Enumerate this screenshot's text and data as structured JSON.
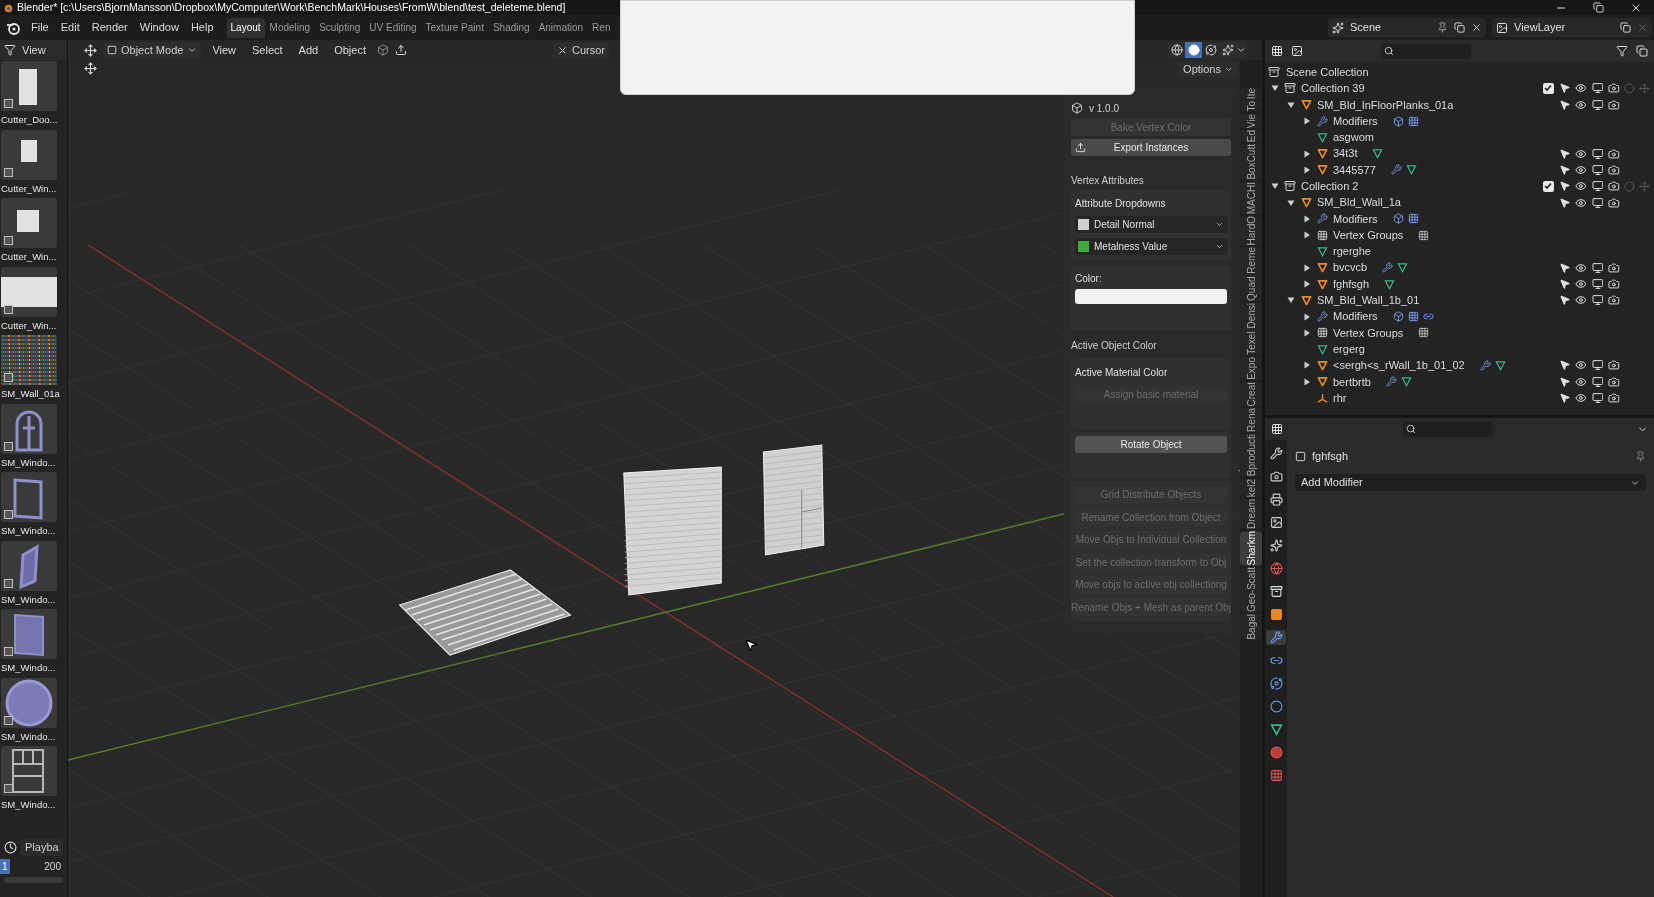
{
  "window": {
    "title": "Blender* [c:\\Users\\BjornMansson\\Dropbox\\MyComputer\\Work\\BenchMark\\Houses\\FromW\\blend\\test_deleteme.blend]"
  },
  "menu": [
    "File",
    "Edit",
    "Render",
    "Window",
    "Help"
  ],
  "workspaces": [
    {
      "label": "Layout",
      "selected": true
    },
    {
      "label": "Modeling",
      "selected": false
    },
    {
      "label": "Sculpting",
      "selected": false
    },
    {
      "label": "UV Editing",
      "selected": false
    },
    {
      "label": "Texture Paint",
      "selected": false
    },
    {
      "label": "Shading",
      "selected": false
    },
    {
      "label": "Animation",
      "selected": false
    },
    {
      "label": "Ren",
      "selected": false
    }
  ],
  "scene": "Scene",
  "view_layer": "ViewLayer",
  "asset_browser": {
    "menu": "View",
    "assets": [
      {
        "name": "Cutter_Doo...",
        "kind": "door"
      },
      {
        "name": "Cutter_Win...",
        "kind": "window-small"
      },
      {
        "name": "Cutter_Win...",
        "kind": "window-square"
      },
      {
        "name": "Cutter_Win...",
        "kind": "window-wide"
      },
      {
        "name": "SM_Wall_01a",
        "kind": "noise"
      },
      {
        "name": "SM_Windo...",
        "kind": "arch"
      },
      {
        "name": "SM_Windo...",
        "kind": "frame"
      },
      {
        "name": "SM_Windo...",
        "kind": "slanted"
      },
      {
        "name": "SM_Windo...",
        "kind": "panel"
      },
      {
        "name": "SM_Windo...",
        "kind": "round"
      },
      {
        "name": "SM_Windo...",
        "kind": "sash"
      }
    ]
  },
  "timeline": {
    "playback": "Playba",
    "start": "1",
    "end": "200"
  },
  "viewport": {
    "mode": "Object Mode",
    "menus": [
      "View",
      "Select",
      "Add",
      "Object"
    ],
    "cursor_tool": "Cursor",
    "options": "Options",
    "shading": [
      {
        "kind": "wireframe",
        "selected": false
      },
      {
        "kind": "solid",
        "selected": true
      },
      {
        "kind": "material",
        "selected": false
      },
      {
        "kind": "rendered",
        "selected": false
      }
    ]
  },
  "sidebar": {
    "version": "v 1.0.0",
    "top_buttons": [
      {
        "label": "Bake Vertex Color",
        "disabled": true
      },
      {
        "label": "Export Instances",
        "disabled": false
      }
    ],
    "vertex_attributes": "Vertex Attributes",
    "dropdown_box": "Attribute Dropdowns",
    "dropdowns": [
      {
        "label": "Detail Normal",
        "color": "#d0d0d0"
      },
      {
        "label": "Metalness Value",
        "color": "#3caa3c"
      }
    ],
    "color_label": "Color:",
    "color_swatch": {
      "color": "#f2f2f0"
    },
    "active_object_color": "Active Object Color",
    "material_box": "Active Material Color",
    "assign_button": {
      "label": "Assign basic material",
      "disabled": true
    },
    "rotate_button": {
      "label": "Rotate Object",
      "disabled": false
    },
    "tools": [
      {
        "label": "Grid Distribute Objects",
        "disabled": true
      },
      {
        "label": "Rename Collection from Object",
        "disabled": true
      },
      {
        "label": "Move Objs to Individual Collection",
        "disabled": true
      },
      {
        "label": "Set the collection transform to Obj",
        "disabled": true
      },
      {
        "label": "Move objs to active obj collectiong",
        "disabled": true
      },
      {
        "label": "Rename Objs + Mesh as parent Obj",
        "disabled": true
      }
    ]
  },
  "sidebar_tabs": [
    {
      "label": "Ite",
      "selected": false
    },
    {
      "label": "To",
      "selected": false
    },
    {
      "label": "Vie",
      "selected": false
    },
    {
      "label": "Ed",
      "selected": false
    },
    {
      "label": "BoxCutt",
      "selected": false
    },
    {
      "label": "MACHI",
      "selected": false
    },
    {
      "label": "HardO",
      "selected": false
    },
    {
      "label": "Quad Reme",
      "selected": false
    },
    {
      "label": "Texel Densi",
      "selected": false
    },
    {
      "label": "Expo",
      "selected": false
    },
    {
      "label": "Creat",
      "selected": false
    },
    {
      "label": "Rena",
      "selected": false
    },
    {
      "label": "Bproducti",
      "selected": false
    },
    {
      "label": "kel2",
      "selected": false
    },
    {
      "label": "Dream",
      "selected": false
    },
    {
      "label": "Sharkm",
      "selected": true
    },
    {
      "label": "Geo-Scatt",
      "selected": false
    },
    {
      "label": "Bagal",
      "selected": false
    }
  ],
  "outliner": {
    "root": "Scene Collection",
    "items": [
      {
        "name": "Collection 39",
        "kind": "collection",
        "expanded": true,
        "checked": true,
        "children": [
          {
            "name": "SM_Bld_InFloorPlanks_01a",
            "kind": "object",
            "expanded": true,
            "children": [
              {
                "name": "Modifiers",
                "kind": "modifiers",
                "expanded": false,
                "extras": [
                  {
                    "kind": "mod-box"
                  },
                  {
                    "kind": "mod-grid"
                  }
                ]
              },
              {
                "name": "asgwom",
                "kind": "mesh-data"
              },
              {
                "name": "34t3t",
                "kind": "object",
                "expanded": false,
                "extras": [
                  {
                    "kind": "mesh"
                  }
                ]
              },
              {
                "name": "3445577",
                "kind": "object",
                "expanded": false,
                "extras": [
                  {
                    "kind": "wrench"
                  },
                  {
                    "kind": "mesh"
                  }
                ]
              }
            ]
          }
        ]
      },
      {
        "name": "Collection 2",
        "kind": "collection",
        "expanded": true,
        "checked": true,
        "children": [
          {
            "name": "SM_Bld_Wall_1a",
            "kind": "object",
            "expanded": true,
            "children": [
              {
                "name": "Modifiers",
                "kind": "modifiers",
                "expanded": false,
                "extras": [
                  {
                    "kind": "mod-box"
                  },
                  {
                    "kind": "mod-grid"
                  }
                ]
              },
              {
                "name": "Vertex Groups",
                "kind": "vertex-groups",
                "expanded": false,
                "extras": [
                  {
                    "kind": "vgroup"
                  }
                ]
              },
              {
                "name": "rgerghe",
                "kind": "mesh-data"
              },
              {
                "name": "bvcvcb",
                "kind": "object",
                "expanded": false,
                "extras": [
                  {
                    "kind": "wrench"
                  },
                  {
                    "kind": "mesh"
                  }
                ]
              },
              {
                "name": "fghfsgh",
                "kind": "object",
                "expanded": false,
                "extras": [
                  {
                    "kind": "mesh"
                  }
                ]
              }
            ]
          },
          {
            "name": "SM_Bld_Wall_1b_01",
            "kind": "object",
            "expanded": true,
            "children": [
              {
                "name": "Modifiers",
                "kind": "modifiers",
                "expanded": false,
                "extras": [
                  {
                    "kind": "mod-box"
                  },
                  {
                    "kind": "mod-grid"
                  },
                  {
                    "kind": "mod-mirror"
                  }
                ]
              },
              {
                "name": "Vertex Groups",
                "kind": "vertex-groups",
                "expanded": false,
                "extras": [
                  {
                    "kind": "vgroup"
                  }
                ]
              },
              {
                "name": "ergerg",
                "kind": "mesh-data"
              },
              {
                "name": "<sergh<s_rWall_1b_01_02",
                "kind": "object",
                "expanded": false,
                "extras": [
                  {
                    "kind": "wrench"
                  },
                  {
                    "kind": "mesh"
                  }
                ]
              },
              {
                "name": "bertbrtb",
                "kind": "object",
                "expanded": false,
                "extras": [
                  {
                    "kind": "wrench"
                  },
                  {
                    "kind": "mesh"
                  }
                ]
              },
              {
                "name": "rhr",
                "kind": "empty"
              }
            ]
          }
        ]
      }
    ]
  },
  "properties": {
    "tabs": [
      {
        "kind": "tool",
        "selected": false
      },
      {
        "kind": "render",
        "selected": false
      },
      {
        "kind": "output",
        "selected": false
      },
      {
        "kind": "view-layer",
        "selected": false
      },
      {
        "kind": "scene",
        "selected": false
      },
      {
        "kind": "world",
        "selected": false
      },
      {
        "kind": "collection",
        "selected": false
      },
      {
        "kind": "object",
        "selected": false
      },
      {
        "kind": "modifier",
        "selected": true
      },
      {
        "kind": "particles",
        "selected": false
      },
      {
        "kind": "physics",
        "selected": false
      },
      {
        "kind": "constraints",
        "selected": false
      },
      {
        "kind": "data",
        "selected": false
      },
      {
        "kind": "material",
        "selected": false
      },
      {
        "kind": "texture",
        "selected": false
      }
    ],
    "object_name": "fghfsgh",
    "add_modifier": "Add Modifier"
  }
}
